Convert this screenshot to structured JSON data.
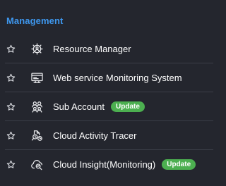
{
  "section": {
    "title": "Management"
  },
  "colors": {
    "background": "#24262e",
    "section_title": "#3e97ee",
    "divider": "#3b3e48",
    "badge": "#4caf50",
    "text": "#ffffff"
  },
  "menu": {
    "items": [
      {
        "label": "Resource Manager",
        "icon": "resource-manager-icon",
        "badge": ""
      },
      {
        "label": "Web service Monitoring System",
        "icon": "monitor-icon",
        "badge": ""
      },
      {
        "label": "Sub Account",
        "icon": "users-icon",
        "badge": "Update"
      },
      {
        "label": "Cloud Activity Tracer",
        "icon": "activity-tracer-icon",
        "badge": ""
      },
      {
        "label": "Cloud Insight(Monitoring)",
        "icon": "cloud-insight-icon",
        "badge": "Update"
      }
    ]
  }
}
